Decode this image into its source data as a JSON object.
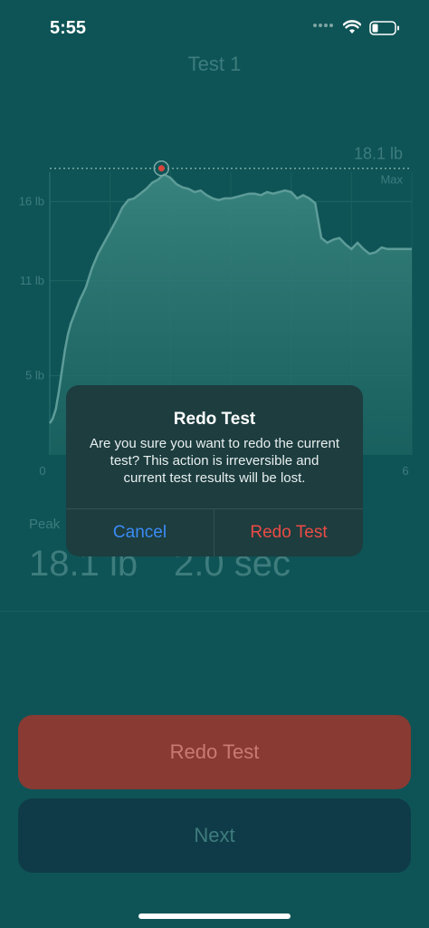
{
  "status_bar": {
    "time": "5:55"
  },
  "nav": {
    "title": "Test 1"
  },
  "chart_data": {
    "type": "area",
    "x_ticks": [
      "0",
      "6"
    ],
    "y_ticks": [
      "16 lb",
      "11 lb",
      "5 lb"
    ],
    "y_tick_values": [
      16,
      11,
      5
    ],
    "xlim": [
      0,
      6
    ],
    "ylim": [
      0,
      19
    ],
    "x": [
      0,
      0.05,
      0.1,
      0.15,
      0.2,
      0.25,
      0.3,
      0.35,
      0.4,
      0.45,
      0.5,
      0.55,
      0.6,
      0.65,
      0.7,
      0.8,
      0.9,
      1.0,
      1.1,
      1.2,
      1.3,
      1.4,
      1.5,
      1.6,
      1.7,
      1.8,
      1.85,
      1.9,
      2.0,
      2.1,
      2.2,
      2.3,
      2.4,
      2.5,
      2.6,
      2.7,
      2.8,
      2.9,
      3.0,
      3.1,
      3.2,
      3.3,
      3.4,
      3.5,
      3.6,
      3.7,
      3.8,
      3.9,
      4.0,
      4.1,
      4.2,
      4.3,
      4.4,
      4.5,
      4.6,
      4.7,
      4.8,
      4.9,
      5.0,
      5.1,
      5.2,
      5.3,
      5.4,
      5.5,
      5.6,
      5.7,
      5.8,
      5.9,
      6.0
    ],
    "y": [
      2.0,
      2.3,
      2.9,
      4.0,
      5.3,
      6.6,
      7.6,
      8.3,
      8.8,
      9.3,
      9.8,
      10.2,
      10.6,
      11.2,
      11.8,
      12.7,
      13.4,
      14.1,
      14.8,
      15.6,
      16.1,
      16.2,
      16.5,
      16.8,
      17.2,
      17.4,
      17.6,
      17.7,
      17.5,
      17.1,
      16.9,
      16.8,
      16.6,
      16.7,
      16.4,
      16.2,
      16.1,
      16.2,
      16.2,
      16.3,
      16.4,
      16.5,
      16.5,
      16.4,
      16.6,
      16.5,
      16.6,
      16.7,
      16.6,
      16.2,
      16.4,
      16.2,
      15.9,
      13.7,
      13.4,
      13.6,
      13.7,
      13.3,
      13.0,
      13.4,
      13.0,
      12.7,
      12.8,
      13.1,
      13.0,
      13.0,
      13.0,
      13.0,
      13.0
    ],
    "peak": {
      "x": 1.85,
      "y": 18.1
    },
    "max_line": {
      "value": "18.1 lb",
      "label": "Max"
    },
    "colors": {
      "fill": "#2e7a76",
      "line": "#5d9c98",
      "marker": "#d9443d"
    }
  },
  "stats": {
    "peak_label": "Peak",
    "peak_value": "18.1 lb",
    "time_value": "2.0 sec"
  },
  "buttons": {
    "redo": "Redo Test",
    "next": "Next"
  },
  "alert": {
    "title": "Redo Test",
    "message": "Are you sure you want to redo the current test? This action is irreversible and current test results will be lost.",
    "cancel": "Cancel",
    "confirm": "Redo Test"
  },
  "colors": {
    "background": "#0e5456",
    "redo_button": "#893a33",
    "next_button": "#0f3b48",
    "cancel_text": "#3b8cf5",
    "confirm_text": "#eb4b45"
  }
}
